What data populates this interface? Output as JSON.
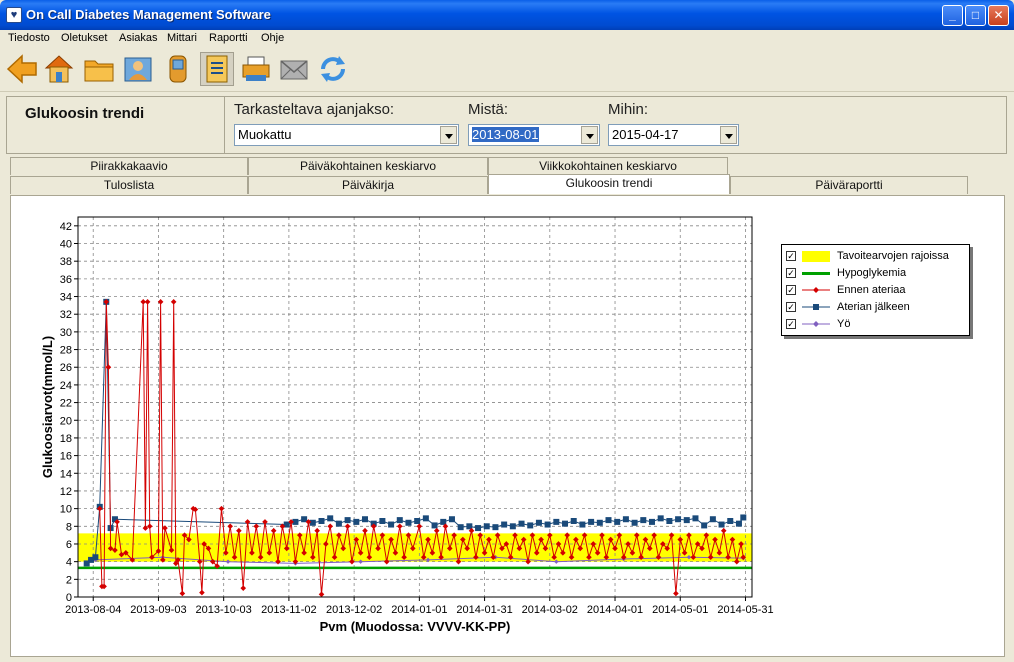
{
  "window": {
    "title": "On Call Diabetes Management Software"
  },
  "menu": [
    "Tiedosto",
    "Oletukset",
    "Asiakas",
    "Mittari",
    "Raportti",
    "Ohje"
  ],
  "toolbar": {
    "buttons": [
      "back-arrow-icon",
      "home-icon",
      "folder-icon",
      "users-icon",
      "meter-device-icon",
      "report-document-icon",
      "printer-icon",
      "email-icon",
      "sync-icon"
    ],
    "active_index": 5
  },
  "header": {
    "title": "Glukoosin trendi",
    "period_label": "Tarkasteltava ajanjakso:",
    "period_value": "Muokattu",
    "from_label": "Mistä:",
    "from_value": "2013-08-01",
    "to_label": "Mihin:",
    "to_value": "2015-04-17"
  },
  "tabs_row1": [
    "Piirakkakaavio",
    "Päiväkohtainen keskiarvo",
    "Viikkokohtainen keskiarvo"
  ],
  "tabs_row2": [
    "Tuloslista",
    "Päiväkirja",
    "Glukoosin trendi",
    "Päiväraportti"
  ],
  "active_tab": "Glukoosin trendi",
  "colors": {
    "target": "#ffff00",
    "hypo": "#00a000",
    "before_meal": "#d40000",
    "after_meal": "#1a4a7a",
    "night": "#8060c0"
  },
  "chart_data": {
    "type": "line",
    "xlabel": "Pvm (Muodossa: VVVV-KK-PP)",
    "ylabel": "Glukoosiarvot(mmol/L)",
    "x_ticks": [
      "2013-08-04",
      "2013-09-03",
      "2013-10-03",
      "2013-11-02",
      "2013-12-02",
      "2014-01-01",
      "2014-01-31",
      "2014-03-02",
      "2014-04-01",
      "2014-05-01",
      "2014-05-31"
    ],
    "xlim": [
      "2013-07-28",
      "2014-06-03"
    ],
    "ylim": [
      0,
      43
    ],
    "y_ticks": [
      0,
      2,
      4,
      6,
      8,
      10,
      12,
      14,
      16,
      18,
      20,
      22,
      24,
      26,
      28,
      30,
      32,
      34,
      36,
      38,
      40,
      42
    ],
    "grid": true,
    "legend_position": "right",
    "target_range": [
      4,
      7.2
    ],
    "hypo_level": 3.3,
    "legend": [
      "Tavoitearvojen rajoissa",
      "Hypoglykemia",
      "Ennen ateriaa",
      "Aterian jälkeen",
      "Yö"
    ],
    "series": [
      {
        "name": "Ennen ateriaa",
        "points": [
          [
            "2013-08-07",
            10.0
          ],
          [
            "2013-08-08",
            1.2
          ],
          [
            "2013-08-09",
            1.2
          ],
          [
            "2013-08-10",
            33.4
          ],
          [
            "2013-08-11",
            26.0
          ],
          [
            "2013-08-12",
            5.5
          ],
          [
            "2013-08-14",
            5.3
          ],
          [
            "2013-08-15",
            8.5
          ],
          [
            "2013-08-17",
            4.8
          ],
          [
            "2013-08-19",
            5.0
          ],
          [
            "2013-08-22",
            4.2
          ],
          [
            "2013-08-27",
            33.4
          ],
          [
            "2013-08-28",
            7.8
          ],
          [
            "2013-08-29",
            33.4
          ],
          [
            "2013-08-30",
            8.0
          ],
          [
            "2013-08-31",
            4.5
          ],
          [
            "2013-09-03",
            5.2
          ],
          [
            "2013-09-04",
            33.4
          ],
          [
            "2013-09-05",
            4.2
          ],
          [
            "2013-09-06",
            7.8
          ],
          [
            "2013-09-09",
            5.3
          ],
          [
            "2013-09-10",
            33.4
          ],
          [
            "2013-09-11",
            3.8
          ],
          [
            "2013-09-12",
            4.2
          ],
          [
            "2013-09-14",
            0.4
          ],
          [
            "2013-09-15",
            7.0
          ],
          [
            "2013-09-17",
            6.5
          ],
          [
            "2013-09-19",
            10.0
          ],
          [
            "2013-09-20",
            9.9
          ],
          [
            "2013-09-22",
            4.0
          ],
          [
            "2013-09-23",
            0.5
          ],
          [
            "2013-09-24",
            6.0
          ],
          [
            "2013-09-26",
            5.5
          ],
          [
            "2013-09-28",
            4.0
          ],
          [
            "2013-09-30",
            3.5
          ],
          [
            "2013-10-02",
            10.0
          ],
          [
            "2013-10-04",
            5.0
          ],
          [
            "2013-10-06",
            8.0
          ],
          [
            "2013-10-08",
            4.5
          ],
          [
            "2013-10-10",
            7.5
          ],
          [
            "2013-10-12",
            1.0
          ],
          [
            "2013-10-14",
            8.5
          ],
          [
            "2013-10-16",
            5.0
          ],
          [
            "2013-10-18",
            8.0
          ],
          [
            "2013-10-20",
            4.5
          ],
          [
            "2013-10-22",
            8.5
          ],
          [
            "2013-10-24",
            5.0
          ],
          [
            "2013-10-26",
            7.5
          ],
          [
            "2013-10-28",
            4.0
          ],
          [
            "2013-10-30",
            8.0
          ],
          [
            "2013-11-01",
            5.5
          ],
          [
            "2013-11-03",
            8.5
          ],
          [
            "2013-11-05",
            4.0
          ],
          [
            "2013-11-07",
            7.0
          ],
          [
            "2013-11-09",
            5.0
          ],
          [
            "2013-11-11",
            8.5
          ],
          [
            "2013-11-13",
            4.5
          ],
          [
            "2013-11-15",
            7.5
          ],
          [
            "2013-11-17",
            0.3
          ],
          [
            "2013-11-19",
            6.0
          ],
          [
            "2013-11-21",
            8.0
          ],
          [
            "2013-11-23",
            4.5
          ],
          [
            "2013-11-25",
            7.0
          ],
          [
            "2013-11-27",
            5.5
          ],
          [
            "2013-11-29",
            8.0
          ],
          [
            "2013-12-01",
            4.0
          ],
          [
            "2013-12-03",
            6.5
          ],
          [
            "2013-12-05",
            5.0
          ],
          [
            "2013-12-07",
            7.5
          ],
          [
            "2013-12-09",
            4.5
          ],
          [
            "2013-12-11",
            8.0
          ],
          [
            "2013-12-13",
            5.5
          ],
          [
            "2013-12-15",
            7.0
          ],
          [
            "2013-12-17",
            4.0
          ],
          [
            "2013-12-19",
            6.5
          ],
          [
            "2013-12-21",
            5.0
          ],
          [
            "2013-12-23",
            8.0
          ],
          [
            "2013-12-25",
            4.5
          ],
          [
            "2013-12-27",
            7.0
          ],
          [
            "2013-12-29",
            5.5
          ],
          [
            "2014-01-01",
            8.0
          ],
          [
            "2014-01-03",
            4.5
          ],
          [
            "2014-01-05",
            6.5
          ],
          [
            "2014-01-07",
            5.0
          ],
          [
            "2014-01-09",
            7.5
          ],
          [
            "2014-01-11",
            4.5
          ],
          [
            "2014-01-13",
            8.0
          ],
          [
            "2014-01-15",
            5.5
          ],
          [
            "2014-01-17",
            7.0
          ],
          [
            "2014-01-19",
            4.0
          ],
          [
            "2014-01-21",
            6.5
          ],
          [
            "2014-01-23",
            5.5
          ],
          [
            "2014-01-25",
            7.5
          ],
          [
            "2014-01-27",
            4.5
          ],
          [
            "2014-01-29",
            7.0
          ],
          [
            "2014-01-31",
            5.0
          ],
          [
            "2014-02-02",
            6.5
          ],
          [
            "2014-02-04",
            4.5
          ],
          [
            "2014-02-06",
            7.0
          ],
          [
            "2014-02-08",
            5.5
          ],
          [
            "2014-02-10",
            6.0
          ],
          [
            "2014-02-12",
            4.5
          ],
          [
            "2014-02-14",
            7.0
          ],
          [
            "2014-02-16",
            5.5
          ],
          [
            "2014-02-18",
            6.5
          ],
          [
            "2014-02-20",
            4.0
          ],
          [
            "2014-02-22",
            7.0
          ],
          [
            "2014-02-24",
            5.0
          ],
          [
            "2014-02-26",
            6.5
          ],
          [
            "2014-02-28",
            5.5
          ],
          [
            "2014-03-02",
            7.0
          ],
          [
            "2014-03-04",
            4.5
          ],
          [
            "2014-03-06",
            6.0
          ],
          [
            "2014-03-08",
            5.0
          ],
          [
            "2014-03-10",
            7.0
          ],
          [
            "2014-03-12",
            4.5
          ],
          [
            "2014-03-14",
            6.5
          ],
          [
            "2014-03-16",
            5.5
          ],
          [
            "2014-03-18",
            7.0
          ],
          [
            "2014-03-20",
            4.5
          ],
          [
            "2014-03-22",
            6.0
          ],
          [
            "2014-03-24",
            5.0
          ],
          [
            "2014-03-26",
            7.0
          ],
          [
            "2014-03-28",
            4.5
          ],
          [
            "2014-03-30",
            6.5
          ],
          [
            "2014-04-01",
            5.5
          ],
          [
            "2014-04-03",
            7.0
          ],
          [
            "2014-04-05",
            4.5
          ],
          [
            "2014-04-07",
            6.0
          ],
          [
            "2014-04-09",
            5.0
          ],
          [
            "2014-04-11",
            7.0
          ],
          [
            "2014-04-13",
            4.5
          ],
          [
            "2014-04-15",
            6.5
          ],
          [
            "2014-04-17",
            5.5
          ],
          [
            "2014-04-19",
            7.0
          ],
          [
            "2014-04-21",
            4.5
          ],
          [
            "2014-04-23",
            6.0
          ],
          [
            "2014-04-25",
            5.5
          ],
          [
            "2014-04-27",
            7.0
          ],
          [
            "2014-04-29",
            0.4
          ],
          [
            "2014-05-01",
            6.5
          ],
          [
            "2014-05-03",
            5.0
          ],
          [
            "2014-05-05",
            7.0
          ],
          [
            "2014-05-07",
            4.5
          ],
          [
            "2014-05-09",
            6.0
          ],
          [
            "2014-05-11",
            5.5
          ],
          [
            "2014-05-13",
            7.0
          ],
          [
            "2014-05-15",
            4.5
          ],
          [
            "2014-05-17",
            6.5
          ],
          [
            "2014-05-19",
            5.0
          ],
          [
            "2014-05-21",
            7.5
          ],
          [
            "2014-05-23",
            4.5
          ],
          [
            "2014-05-25",
            6.5
          ],
          [
            "2014-05-27",
            4.0
          ],
          [
            "2014-05-29",
            6.0
          ],
          [
            "2014-05-30",
            4.5
          ]
        ]
      },
      {
        "name": "Aterian jälkeen",
        "points": [
          [
            "2013-08-01",
            3.8
          ],
          [
            "2013-08-03",
            4.2
          ],
          [
            "2013-08-05",
            4.5
          ],
          [
            "2013-08-07",
            10.2
          ],
          [
            "2013-08-10",
            33.4
          ],
          [
            "2013-08-12",
            7.8
          ],
          [
            "2013-08-14",
            8.8
          ],
          [
            "2013-11-01",
            8.2
          ],
          [
            "2013-11-05",
            8.5
          ],
          [
            "2013-11-09",
            8.8
          ],
          [
            "2013-11-13",
            8.4
          ],
          [
            "2013-11-17",
            8.6
          ],
          [
            "2013-11-21",
            8.9
          ],
          [
            "2013-11-25",
            8.3
          ],
          [
            "2013-11-29",
            8.7
          ],
          [
            "2013-12-03",
            8.5
          ],
          [
            "2013-12-07",
            8.8
          ],
          [
            "2013-12-11",
            8.3
          ],
          [
            "2013-12-15",
            8.6
          ],
          [
            "2013-12-19",
            8.2
          ],
          [
            "2013-12-23",
            8.7
          ],
          [
            "2013-12-27",
            8.4
          ],
          [
            "2013-12-31",
            8.6
          ],
          [
            "2014-01-04",
            8.9
          ],
          [
            "2014-01-08",
            8.1
          ],
          [
            "2014-01-12",
            8.5
          ],
          [
            "2014-01-16",
            8.8
          ],
          [
            "2014-01-20",
            7.9
          ],
          [
            "2014-01-24",
            8.0
          ],
          [
            "2014-01-28",
            7.8
          ],
          [
            "2014-02-01",
            8.0
          ],
          [
            "2014-02-05",
            7.9
          ],
          [
            "2014-02-09",
            8.2
          ],
          [
            "2014-02-13",
            8.0
          ],
          [
            "2014-02-17",
            8.3
          ],
          [
            "2014-02-21",
            8.1
          ],
          [
            "2014-02-25",
            8.4
          ],
          [
            "2014-03-01",
            8.2
          ],
          [
            "2014-03-05",
            8.5
          ],
          [
            "2014-03-09",
            8.3
          ],
          [
            "2014-03-13",
            8.6
          ],
          [
            "2014-03-17",
            8.2
          ],
          [
            "2014-03-21",
            8.5
          ],
          [
            "2014-03-25",
            8.4
          ],
          [
            "2014-03-29",
            8.7
          ],
          [
            "2014-04-02",
            8.5
          ],
          [
            "2014-04-06",
            8.8
          ],
          [
            "2014-04-10",
            8.4
          ],
          [
            "2014-04-14",
            8.7
          ],
          [
            "2014-04-18",
            8.5
          ],
          [
            "2014-04-22",
            8.9
          ],
          [
            "2014-04-26",
            8.6
          ],
          [
            "2014-04-30",
            8.8
          ],
          [
            "2014-05-04",
            8.7
          ],
          [
            "2014-05-08",
            8.9
          ],
          [
            "2014-05-12",
            8.1
          ],
          [
            "2014-05-16",
            8.8
          ],
          [
            "2014-05-20",
            8.2
          ],
          [
            "2014-05-24",
            8.6
          ],
          [
            "2014-05-28",
            8.3
          ],
          [
            "2014-05-30",
            9.0
          ]
        ]
      },
      {
        "name": "Yö",
        "points": [
          [
            "2013-08-05",
            4.2
          ],
          [
            "2013-09-05",
            4.5
          ],
          [
            "2013-10-05",
            4.0
          ],
          [
            "2013-11-05",
            3.8
          ],
          [
            "2013-12-05",
            4.0
          ],
          [
            "2014-01-05",
            4.2
          ],
          [
            "2014-02-05",
            4.5
          ],
          [
            "2014-03-05",
            4.0
          ],
          [
            "2014-04-05",
            4.3
          ],
          [
            "2014-05-05",
            4.5
          ],
          [
            "2014-05-30",
            4.4
          ]
        ]
      }
    ]
  }
}
